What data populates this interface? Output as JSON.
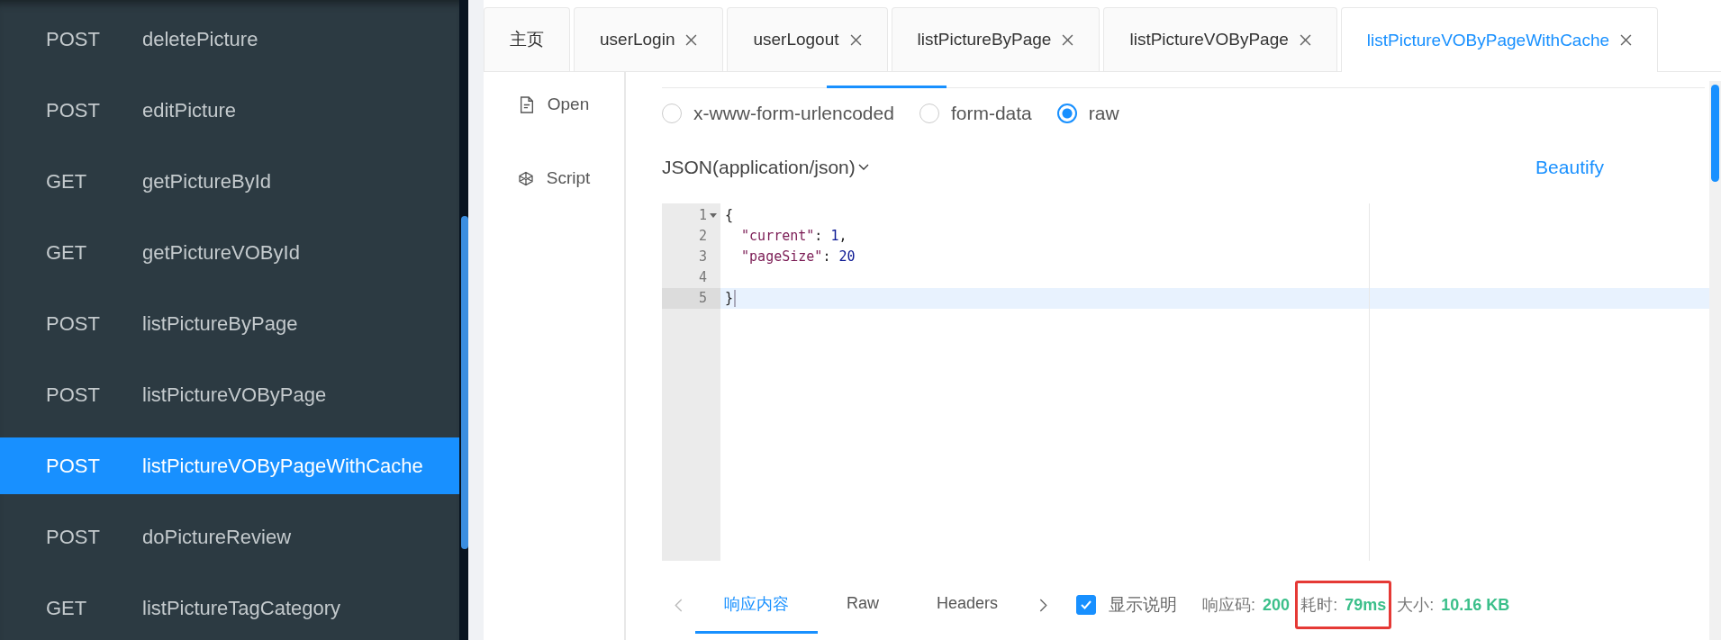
{
  "sidebar": {
    "items": [
      {
        "method": "POST",
        "name": "deletePicture",
        "selected": false
      },
      {
        "method": "POST",
        "name": "editPicture",
        "selected": false
      },
      {
        "method": "GET",
        "name": "getPictureById",
        "selected": false
      },
      {
        "method": "GET",
        "name": "getPictureVOById",
        "selected": false
      },
      {
        "method": "POST",
        "name": "listPictureByPage",
        "selected": false
      },
      {
        "method": "POST",
        "name": "listPictureVOByPage",
        "selected": false
      },
      {
        "method": "POST",
        "name": "listPictureVOByPageWithCache",
        "selected": true
      },
      {
        "method": "POST",
        "name": "doPictureReview",
        "selected": false
      },
      {
        "method": "GET",
        "name": "listPictureTagCategory",
        "selected": false
      }
    ]
  },
  "tabs": [
    {
      "label": "主页",
      "closable": false,
      "selected": false
    },
    {
      "label": "userLogin",
      "closable": true,
      "selected": false
    },
    {
      "label": "userLogout",
      "closable": true,
      "selected": false
    },
    {
      "label": "listPictureByPage",
      "closable": true,
      "selected": false
    },
    {
      "label": "listPictureVOByPage",
      "closable": true,
      "selected": false
    },
    {
      "label": "listPictureVOByPageWithCache",
      "closable": true,
      "selected": true
    }
  ],
  "side_actions": [
    {
      "kind": "open",
      "label": "Open"
    },
    {
      "kind": "script",
      "label": "Script"
    }
  ],
  "body_types": [
    {
      "label": "x-www-form-urlencoded",
      "selected": false
    },
    {
      "label": "form-data",
      "selected": false
    },
    {
      "label": "raw",
      "selected": true
    }
  ],
  "content_type": "JSON(application/json)",
  "beautify": "Beautify",
  "editor": {
    "lines": [
      {
        "number": "1",
        "fold": true,
        "active": false,
        "segments": [
          {
            "kind": "punct",
            "text": "{"
          }
        ]
      },
      {
        "number": "2",
        "fold": false,
        "active": false,
        "segments": [
          {
            "kind": "key",
            "text": "  \"current\""
          },
          {
            "kind": "punct",
            "text": ": "
          },
          {
            "kind": "number",
            "text": "1"
          },
          {
            "kind": "punct",
            "text": ","
          }
        ]
      },
      {
        "number": "3",
        "fold": false,
        "active": false,
        "segments": [
          {
            "kind": "key",
            "text": "  \"pageSize\""
          },
          {
            "kind": "punct",
            "text": ": "
          },
          {
            "kind": "number",
            "text": "20"
          }
        ]
      },
      {
        "number": "4",
        "fold": false,
        "active": false
      },
      {
        "number": "5",
        "fold": false,
        "active": true,
        "segments": [
          {
            "kind": "punct",
            "text": "}"
          }
        ]
      }
    ]
  },
  "response": {
    "tabs": [
      {
        "label": "响应内容",
        "selected": true
      },
      {
        "label": "Raw",
        "selected": false
      },
      {
        "label": "Headers",
        "selected": false
      }
    ],
    "show_description": {
      "label": "显示说明",
      "checked": true
    },
    "stats": [
      {
        "label": "响应码:",
        "value": "200",
        "highlighted": false
      },
      {
        "label": "耗时:",
        "value": "79ms",
        "highlighted": true
      },
      {
        "label": "大小:",
        "value": "10.16 KB",
        "highlighted": false
      }
    ]
  }
}
